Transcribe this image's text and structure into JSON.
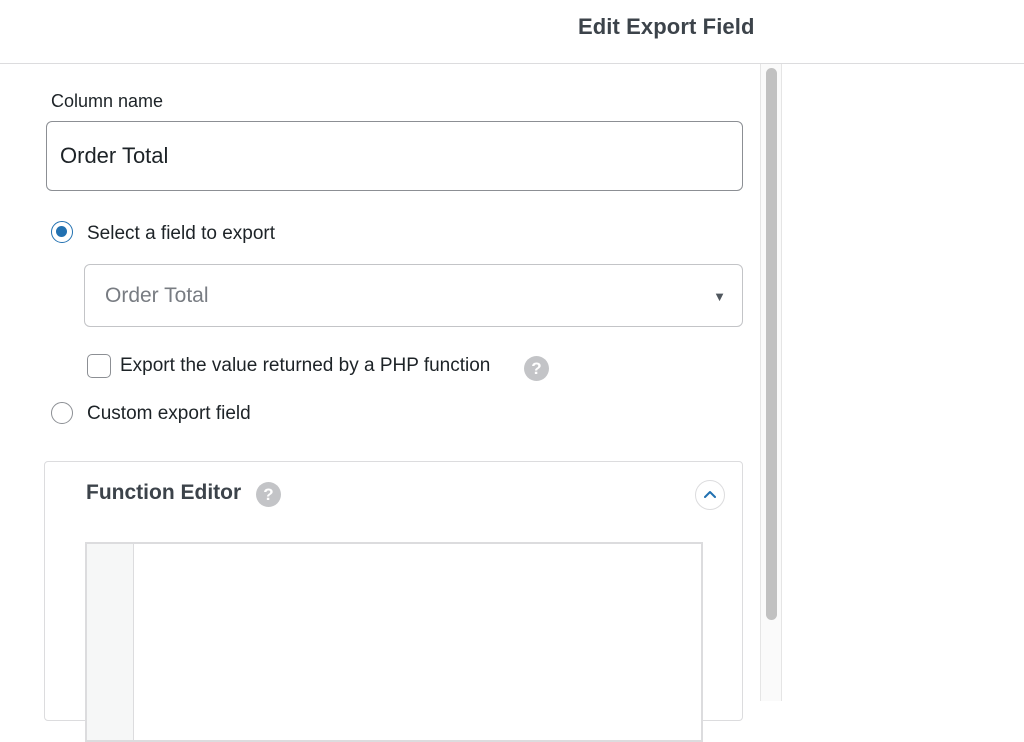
{
  "header": {
    "title": "Edit Export Field"
  },
  "form": {
    "column_name_label": "Column name",
    "column_name_value": "Order Total",
    "option_select_field_label": "Select a field to export",
    "option_select_field_checked": true,
    "field_select_value": "Order Total",
    "php_function_checkbox_label": "Export the value returned by a PHP function",
    "php_function_checked": false,
    "option_custom_field_label": "Custom export field",
    "option_custom_field_checked": false
  },
  "function_editor": {
    "title": "Function Editor",
    "help_icon": "question-mark",
    "collapse_icon": "chevron-up-icon"
  },
  "colors": {
    "accent": "#2271b1",
    "help_icon_bg": "#c3c4c7",
    "border": "#dcdcde"
  }
}
